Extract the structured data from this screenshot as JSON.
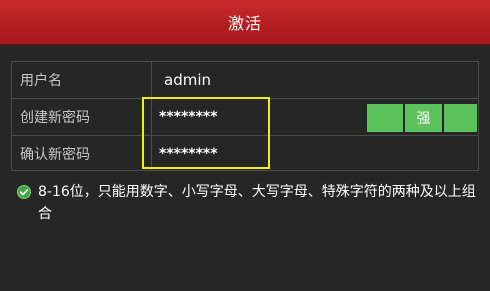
{
  "dialog": {
    "title": "激活"
  },
  "form": {
    "username_label": "用户名",
    "username_value": "admin",
    "new_password_label": "创建新密码",
    "new_password_value": "********",
    "confirm_password_label": "确认新密码",
    "confirm_password_value": "********"
  },
  "strength": {
    "label": "强",
    "level": "strong",
    "bar_color": "#5cc25c"
  },
  "hint": {
    "icon": "check-circle-icon",
    "text": "8-16位，只能用数字、小写字母、大写字母、特殊字符的两种及以上组合"
  },
  "colors": {
    "title_bar": "#b41f22",
    "highlight_border": "#f2ee12",
    "background": "#262626"
  }
}
